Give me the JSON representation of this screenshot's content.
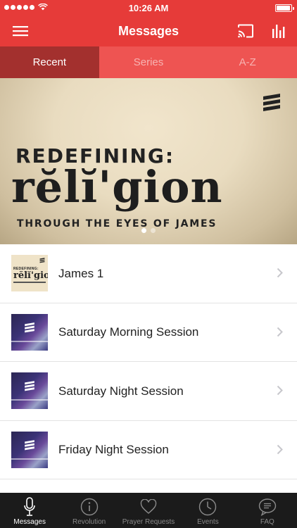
{
  "status_bar": {
    "time": "10:26 AM"
  },
  "nav": {
    "title": "Messages"
  },
  "tabs": [
    {
      "label": "Recent",
      "active": true
    },
    {
      "label": "Series",
      "active": false
    },
    {
      "label": "A-Z",
      "active": false
    }
  ],
  "hero": {
    "line1": "REDEFINING:",
    "line2": "rĕlĭ'gion",
    "line3": "THROUGH THE EYES OF JAMES",
    "pages": 2,
    "current_page": 1
  },
  "messages": [
    {
      "title": "James 1",
      "thumb_text_1": "REDEFINING:",
      "thumb_text_2": "rĕlĭ'gion"
    },
    {
      "title": "Saturday Morning Session"
    },
    {
      "title": "Saturday Night Session"
    },
    {
      "title": "Friday Night Session"
    }
  ],
  "tab_bar": [
    {
      "label": "Messages",
      "icon": "microphone-icon",
      "active": true
    },
    {
      "label": "Revolution",
      "icon": "info-icon",
      "active": false
    },
    {
      "label": "Prayer Requests",
      "icon": "heart-icon",
      "active": false
    },
    {
      "label": "Events",
      "icon": "clock-icon",
      "active": false
    },
    {
      "label": "FAQ",
      "icon": "chat-bubble-icon",
      "active": false
    }
  ],
  "colors": {
    "brand_red": "#e63b39",
    "active_tab": "#a3302e",
    "inactive_tab": "#ee5452",
    "tab_bar_bg": "#1b1b1b"
  }
}
